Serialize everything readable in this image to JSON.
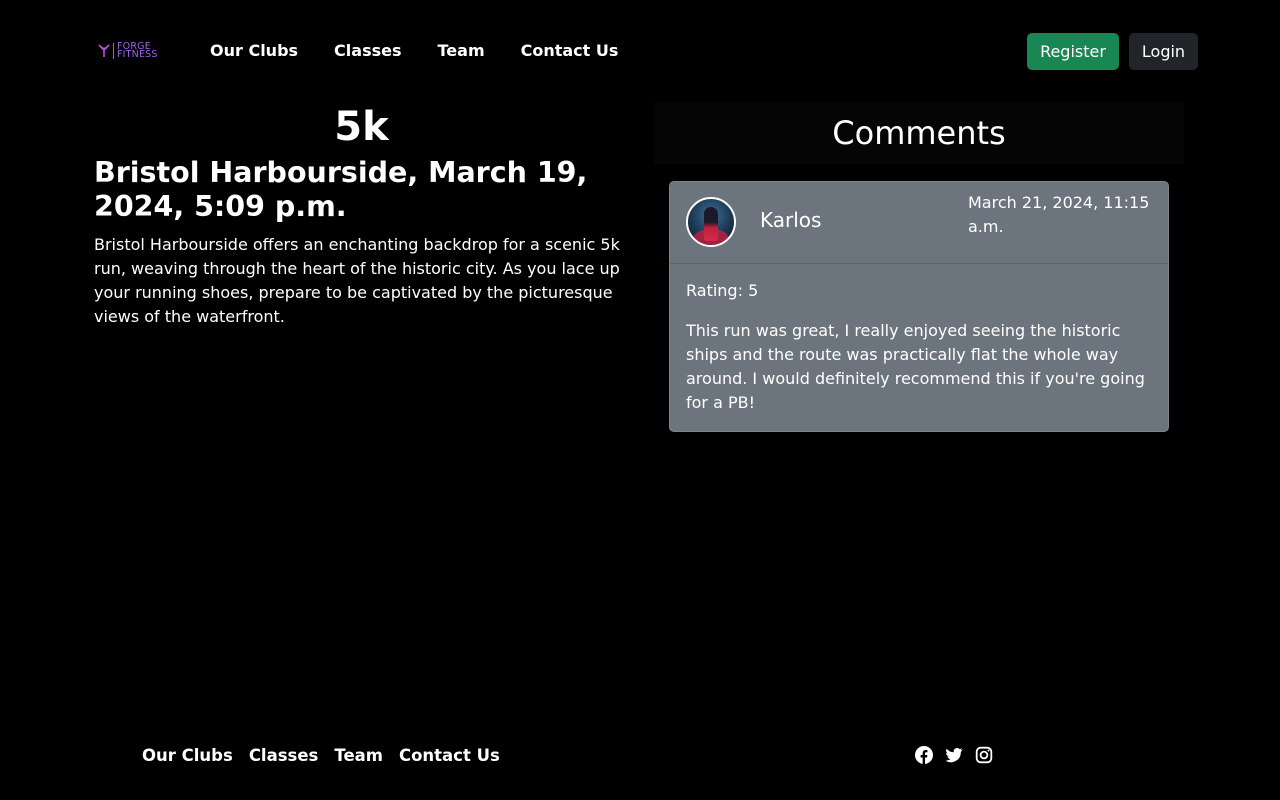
{
  "brand": {
    "logo_line1": "FORGE",
    "logo_line2": "FITNESS",
    "logo_color": "#9d63e8"
  },
  "nav": {
    "items": [
      {
        "label": "Our Clubs"
      },
      {
        "label": "Classes"
      },
      {
        "label": "Team"
      },
      {
        "label": "Contact Us"
      }
    ]
  },
  "auth": {
    "register_label": "Register",
    "login_label": "Login",
    "register_color": "#198754",
    "login_color": "#212529"
  },
  "event": {
    "title": "5k",
    "location_date": "Bristol Harbourside, March 19, 2024, 5:09 p.m.",
    "description": "Bristol Harbourside offers an enchanting backdrop for a scenic 5k run, weaving through the heart of the historic city. As you lace up your running shoes, prepare to be captivated by the picturesque views of the waterfront."
  },
  "comments": {
    "heading": "Comments",
    "items": [
      {
        "author": "Karlos",
        "date": "March 21, 2024, 11:15 a.m.",
        "rating": "Rating: 5",
        "text": "This run was great, I really enjoyed seeing the historic ships and the route was practically flat the whole way around. I would definitely recommend this if you're going for a PB!"
      }
    ]
  },
  "footer": {
    "items": [
      {
        "label": "Our Clubs"
      },
      {
        "label": "Classes"
      },
      {
        "label": "Team"
      },
      {
        "label": "Contact Us"
      }
    ],
    "socials": [
      "facebook-icon",
      "twitter-icon",
      "instagram-icon"
    ]
  }
}
